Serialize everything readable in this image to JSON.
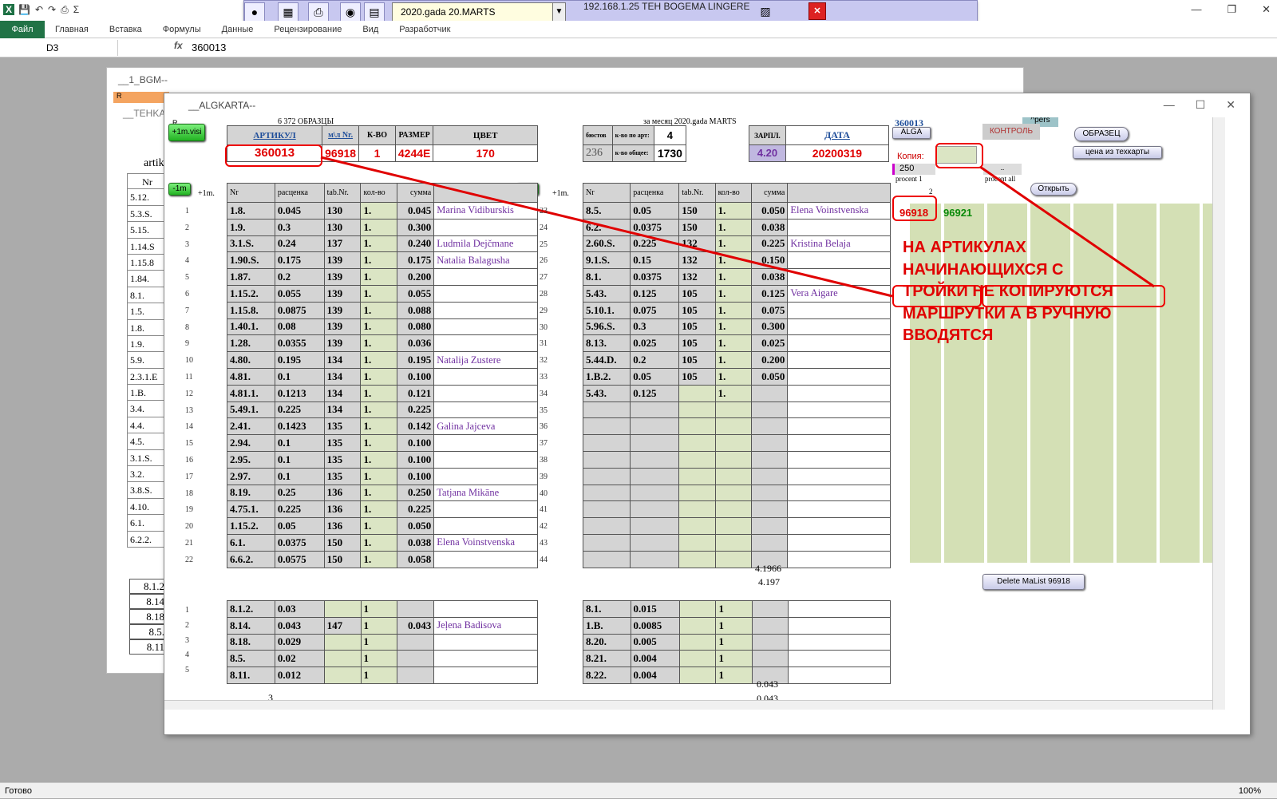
{
  "excel": {
    "menu": [
      "Главная",
      "Вставка",
      "Формулы",
      "Данные",
      "Рецензирование",
      "Вид",
      "Разработчик"
    ],
    "file_tab": "Файл",
    "cell_ref": "D3",
    "formula_value": "360013",
    "status": "Готово",
    "zoom": "100%"
  },
  "toolbar": {
    "month_combo": "2020.gada 20.MARTS",
    "ip_label": "192.168.1.25 TEH BOGEMA LINGERE"
  },
  "back_window": {
    "title": "__1_BGM--",
    "r_label": "R",
    "sheet_label": "__TEHKAR",
    "artikul_partial": "artik",
    "nr_header": "Nr",
    "list": [
      "5.12.",
      "5.3.S.",
      "5.15.",
      "1.14.S",
      "1.15.8",
      "1.84.",
      "8.1.",
      "1.5.",
      "1.8.",
      "1.9.",
      "5.9.",
      "2.3.1.E",
      "1.B.",
      "3.4.",
      "4.4.",
      "4.5.",
      "3.1.S.",
      "3.2.",
      "3.8.S.",
      "4.10.",
      "6.1.",
      "6.2.2."
    ],
    "lower": [
      "8.1.2",
      "8.14",
      "8.18",
      "8.5.",
      "8.11"
    ]
  },
  "main_window": {
    "title": "__ALGKARTA--",
    "r_label": "R",
    "samples_count": "6 372 ОБРАЗЦЫ",
    "month_label": "за месяц 2020.gada MARTS",
    "article_link": "360013",
    "alga_btn": "ALGA",
    "pers_btn": "^pers",
    "kontrol_btn": "КОНТРОЛЬ",
    "obrazec_btn": "ОБРАЗЕЦ",
    "price_btn": "цена из техкарты",
    "open_btn": "Открыть",
    "delete_btn": "Delete MaList 96918",
    "visi_btn": "+1m.visi",
    "minus1m": "-1m",
    "plus1m": "+1m.",
    "kopija_label": "Копия:",
    "procent_value": "250",
    "procent1": "procent 1",
    "procent_all": "procent all",
    "small_2": "2",
    "dots": "..",
    "res1": "96918",
    "res2": "96921",
    "sum1": "4.1966",
    "sum2": "4.197",
    "sum3": "0.043",
    "sum4": "0.043",
    "bottom_3": "3"
  },
  "header_table": {
    "labels": [
      "АРТИКУЛ",
      "м\\л Nr.",
      "К-ВО",
      "РАЗМЕР",
      "ЦВЕТ"
    ],
    "values": [
      "360013",
      "96918",
      "1",
      "4244E",
      "170"
    ]
  },
  "counts": {
    "biustov_label": "бюстов",
    "per_art_label": "к-во по арт:",
    "per_art": "4",
    "biustov": "236",
    "total_label": "к-во общее:",
    "total": "1730"
  },
  "zarp": {
    "label": "ЗАРПЛ.",
    "date_label": "ДАТА",
    "value": "4.20",
    "date": "20200319"
  },
  "col_headers": [
    "Nr",
    "расценка",
    "tab.Nr.",
    "кол-во",
    "сумма"
  ],
  "left_rows": [
    [
      "1.8.",
      "0.045",
      "130",
      "1.",
      "0.045",
      "Marina Vidiburskis"
    ],
    [
      "1.9.",
      "0.3",
      "130",
      "1.",
      "0.300",
      ""
    ],
    [
      "3.1.S.",
      "0.24",
      "137",
      "1.",
      "0.240",
      "Ludmila Dejčmane"
    ],
    [
      "1.90.S.",
      "0.175",
      "139",
      "1.",
      "0.175",
      "Natalia Balagusha"
    ],
    [
      "1.87.",
      "0.2",
      "139",
      "1.",
      "0.200",
      ""
    ],
    [
      "1.15.2.",
      "0.055",
      "139",
      "1.",
      "0.055",
      ""
    ],
    [
      "1.15.8.",
      "0.0875",
      "139",
      "1.",
      "0.088",
      ""
    ],
    [
      "1.40.1.",
      "0.08",
      "139",
      "1.",
      "0.080",
      ""
    ],
    [
      "1.28.",
      "0.0355",
      "139",
      "1.",
      "0.036",
      ""
    ],
    [
      "4.80.",
      "0.195",
      "134",
      "1.",
      "0.195",
      "Natalija Zustere"
    ],
    [
      "4.81.",
      "0.1",
      "134",
      "1.",
      "0.100",
      ""
    ],
    [
      "4.81.1.",
      "0.1213",
      "134",
      "1.",
      "0.121",
      ""
    ],
    [
      "5.49.1.",
      "0.225",
      "134",
      "1.",
      "0.225",
      ""
    ],
    [
      "2.41.",
      "0.1423",
      "135",
      "1.",
      "0.142",
      "Galina Jajceva"
    ],
    [
      "2.94.",
      "0.1",
      "135",
      "1.",
      "0.100",
      ""
    ],
    [
      "2.95.",
      "0.1",
      "135",
      "1.",
      "0.100",
      ""
    ],
    [
      "2.97.",
      "0.1",
      "135",
      "1.",
      "0.100",
      ""
    ],
    [
      "8.19.",
      "0.25",
      "136",
      "1.",
      "0.250",
      "Tatjana Mikāne"
    ],
    [
      "4.75.1.",
      "0.225",
      "136",
      "1.",
      "0.225",
      ""
    ],
    [
      "1.15.2.",
      "0.05",
      "136",
      "1.",
      "0.050",
      ""
    ],
    [
      "6.1.",
      "0.0375",
      "150",
      "1.",
      "0.038",
      "Elena Voinstvenska"
    ],
    [
      "6.6.2.",
      "0.0575",
      "150",
      "1.",
      "0.058",
      ""
    ]
  ],
  "right_rows": [
    [
      "8.5.",
      "0.05",
      "150",
      "1.",
      "0.050",
      "Elena Voinstvenska"
    ],
    [
      "6.2.",
      "0.0375",
      "150",
      "1.",
      "0.038",
      ""
    ],
    [
      "2.60.S.",
      "0.225",
      "132",
      "1.",
      "0.225",
      "Kristina Belaja"
    ],
    [
      "9.1.S.",
      "0.15",
      "132",
      "1.",
      "0.150",
      ""
    ],
    [
      "8.1.",
      "0.0375",
      "132",
      "1.",
      "0.038",
      ""
    ],
    [
      "5.43.",
      "0.125",
      "105",
      "1.",
      "0.125",
      "Vera Aigare"
    ],
    [
      "5.10.1.",
      "0.075",
      "105",
      "1.",
      "0.075",
      ""
    ],
    [
      "5.96.S.",
      "0.3",
      "105",
      "1.",
      "0.300",
      ""
    ],
    [
      "8.13.",
      "0.025",
      "105",
      "1.",
      "0.025",
      ""
    ],
    [
      "5.44.D.",
      "0.2",
      "105",
      "1.",
      "0.200",
      ""
    ],
    [
      "1.B.2.",
      "0.05",
      "105",
      "1.",
      "0.050",
      ""
    ],
    [
      "5.43.",
      "0.125",
      "",
      "1.",
      "",
      ""
    ],
    [
      "",
      "",
      "",
      "",
      "",
      ""
    ],
    [
      "",
      "",
      "",
      "",
      "",
      ""
    ],
    [
      "",
      "",
      "",
      "",
      "",
      ""
    ],
    [
      "",
      "",
      "",
      "",
      "",
      ""
    ],
    [
      "",
      "",
      "",
      "",
      "",
      ""
    ],
    [
      "",
      "",
      "",
      "",
      "",
      ""
    ],
    [
      "",
      "",
      "",
      "",
      "",
      ""
    ],
    [
      "",
      "",
      "",
      "",
      "",
      ""
    ],
    [
      "",
      "",
      "",
      "",
      "",
      ""
    ],
    [
      "",
      "",
      "",
      "",
      "",
      ""
    ]
  ],
  "left_lower": [
    [
      "8.1.2.",
      "0.03",
      "",
      "1",
      "",
      ""
    ],
    [
      "8.14.",
      "0.043",
      "147",
      "1",
      "0.043",
      "Jeļena Badisova"
    ],
    [
      "8.18.",
      "0.029",
      "",
      "1",
      "",
      ""
    ],
    [
      "8.5.",
      "0.02",
      "",
      "1",
      "",
      ""
    ],
    [
      "8.11.",
      "0.012",
      "",
      "1",
      "",
      ""
    ]
  ],
  "right_lower": [
    [
      "8.1.",
      "0.015",
      "",
      "1",
      "",
      ""
    ],
    [
      "1.B.",
      "0.0085",
      "",
      "1",
      "",
      ""
    ],
    [
      "8.20.",
      "0.005",
      "",
      "1",
      "",
      ""
    ],
    [
      "8.21.",
      "0.004",
      "",
      "1",
      "",
      ""
    ],
    [
      "8.22.",
      "0.004",
      "",
      "1",
      "",
      ""
    ]
  ],
  "annotation": {
    "lines": [
      "НА АРТИКУЛАХ",
      "НАЧИНАЮЩИХСЯ С",
      "ТРОЙКИ НЕ КОПИРУЮТСЯ",
      "МАРШРУТКИ А В РУЧНУЮ",
      "ВВОДЯТСЯ"
    ]
  }
}
